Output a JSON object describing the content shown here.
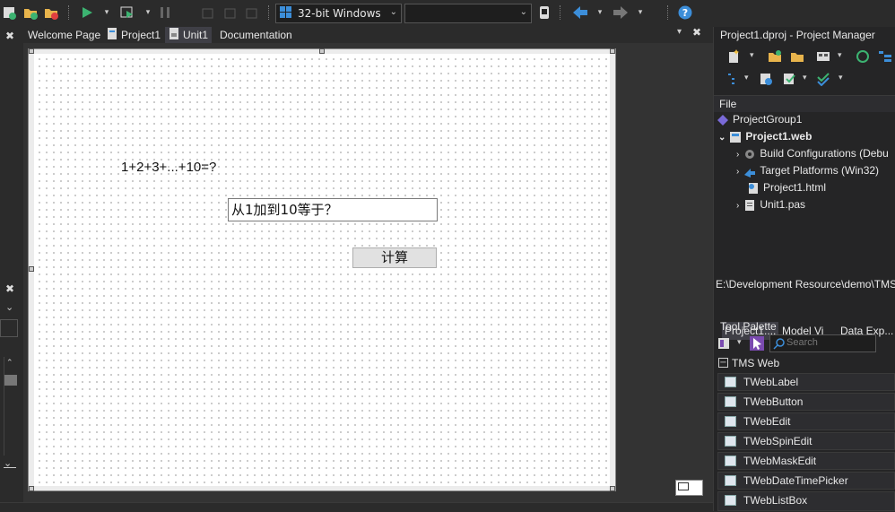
{
  "toolbar": {
    "platform_value": "32-bit Windows",
    "config_value": ""
  },
  "tabs": {
    "welcome": "Welcome Page",
    "project": "Project1",
    "unit": "Unit1",
    "documentation": "Documentation"
  },
  "form": {
    "label_text": "1+2+3+...+10=?",
    "edit_text": "从1加到10等于？",
    "button_text": "计算"
  },
  "project_manager": {
    "title": "Project1.dproj - Project Manager",
    "file_header": "File",
    "items": [
      {
        "label": "ProjectGroup1",
        "bold": false
      },
      {
        "label": "Project1.web",
        "bold": true
      },
      {
        "label": "Build Configurations (Debu",
        "bold": false
      },
      {
        "label": "Target Platforms (Win32)",
        "bold": false
      },
      {
        "label": "Project1.html",
        "bold": false
      },
      {
        "label": "Unit1.pas",
        "bold": false
      }
    ],
    "path": "E:\\Development Resource\\demo\\TMS",
    "bottom_tabs": [
      "Project1....",
      "Model Vi",
      "Data Exp..."
    ]
  },
  "tool_palette": {
    "title": "Tool Palette",
    "search_placeholder": "Search",
    "category": "TMS Web",
    "items": [
      "TWebLabel",
      "TWebButton",
      "TWebEdit",
      "TWebSpinEdit",
      "TWebMaskEdit",
      "TWebDateTimePicker",
      "TWebListBox"
    ]
  },
  "colors": {
    "accent": "#007acc",
    "play": "#3cb371",
    "background": "#2b2b2b"
  }
}
